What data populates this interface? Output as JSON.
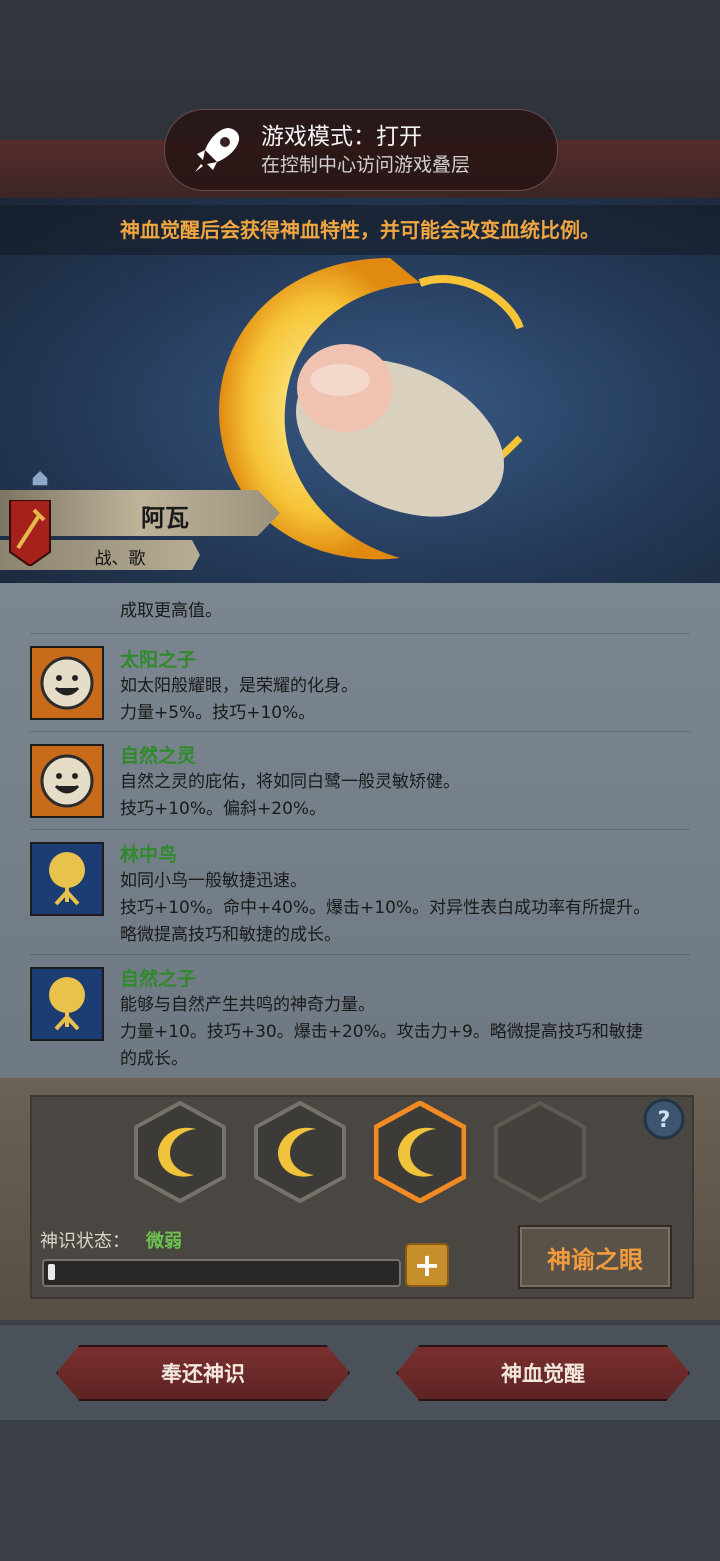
{
  "toast": {
    "title": "游戏模式：打开",
    "subtitle": "在控制中心访问游戏叠层",
    "icon": "rocket-icon"
  },
  "hint": "神血觉醒后会获得神血特性，并可能会改变血统比例。",
  "character": {
    "name": "阿瓦",
    "tags": "战、歌",
    "emblem": "sword-shield-icon"
  },
  "traits_partial": "成取更高值。",
  "traits": [
    {
      "name": "太阳之子",
      "icon": "sun-face-icon",
      "lines": [
        "如太阳般耀眼，是荣耀的化身。",
        "力量+5%。技巧+10%。"
      ]
    },
    {
      "name": "自然之灵",
      "icon": "sun-face-icon",
      "lines": [
        "自然之灵的庇佑，将如同白鹭一般灵敏矫健。",
        "技巧+10%。偏斜+20%。"
      ]
    },
    {
      "name": "林中鸟",
      "icon": "tree-icon",
      "lines": [
        "如同小鸟一般敏捷迅速。",
        "技巧+10%。命中+40%。爆击+10%。对异性表白成功率有所提升。",
        "略微提高技巧和敏捷的成长。"
      ]
    },
    {
      "name": "自然之子",
      "icon": "tree-icon",
      "lines": [
        "能够与自然产生共鸣的神奇力量。",
        "力量+10。技巧+30。爆击+20%。攻击力+9。略微提高技巧和敏捷",
        "的成长。"
      ]
    }
  ],
  "panel": {
    "state_label": "神识状态：",
    "state_value": "微弱",
    "progress": 0.02,
    "oracle_button": "神谕之眼",
    "slots": [
      "filled",
      "filled",
      "selected",
      "empty"
    ]
  },
  "actions": {
    "left": "奉还神识",
    "right": "神血觉醒"
  },
  "colors": {
    "accent": "#f19b3c",
    "green": "#2f8a2a",
    "hint": "#f1a640"
  }
}
